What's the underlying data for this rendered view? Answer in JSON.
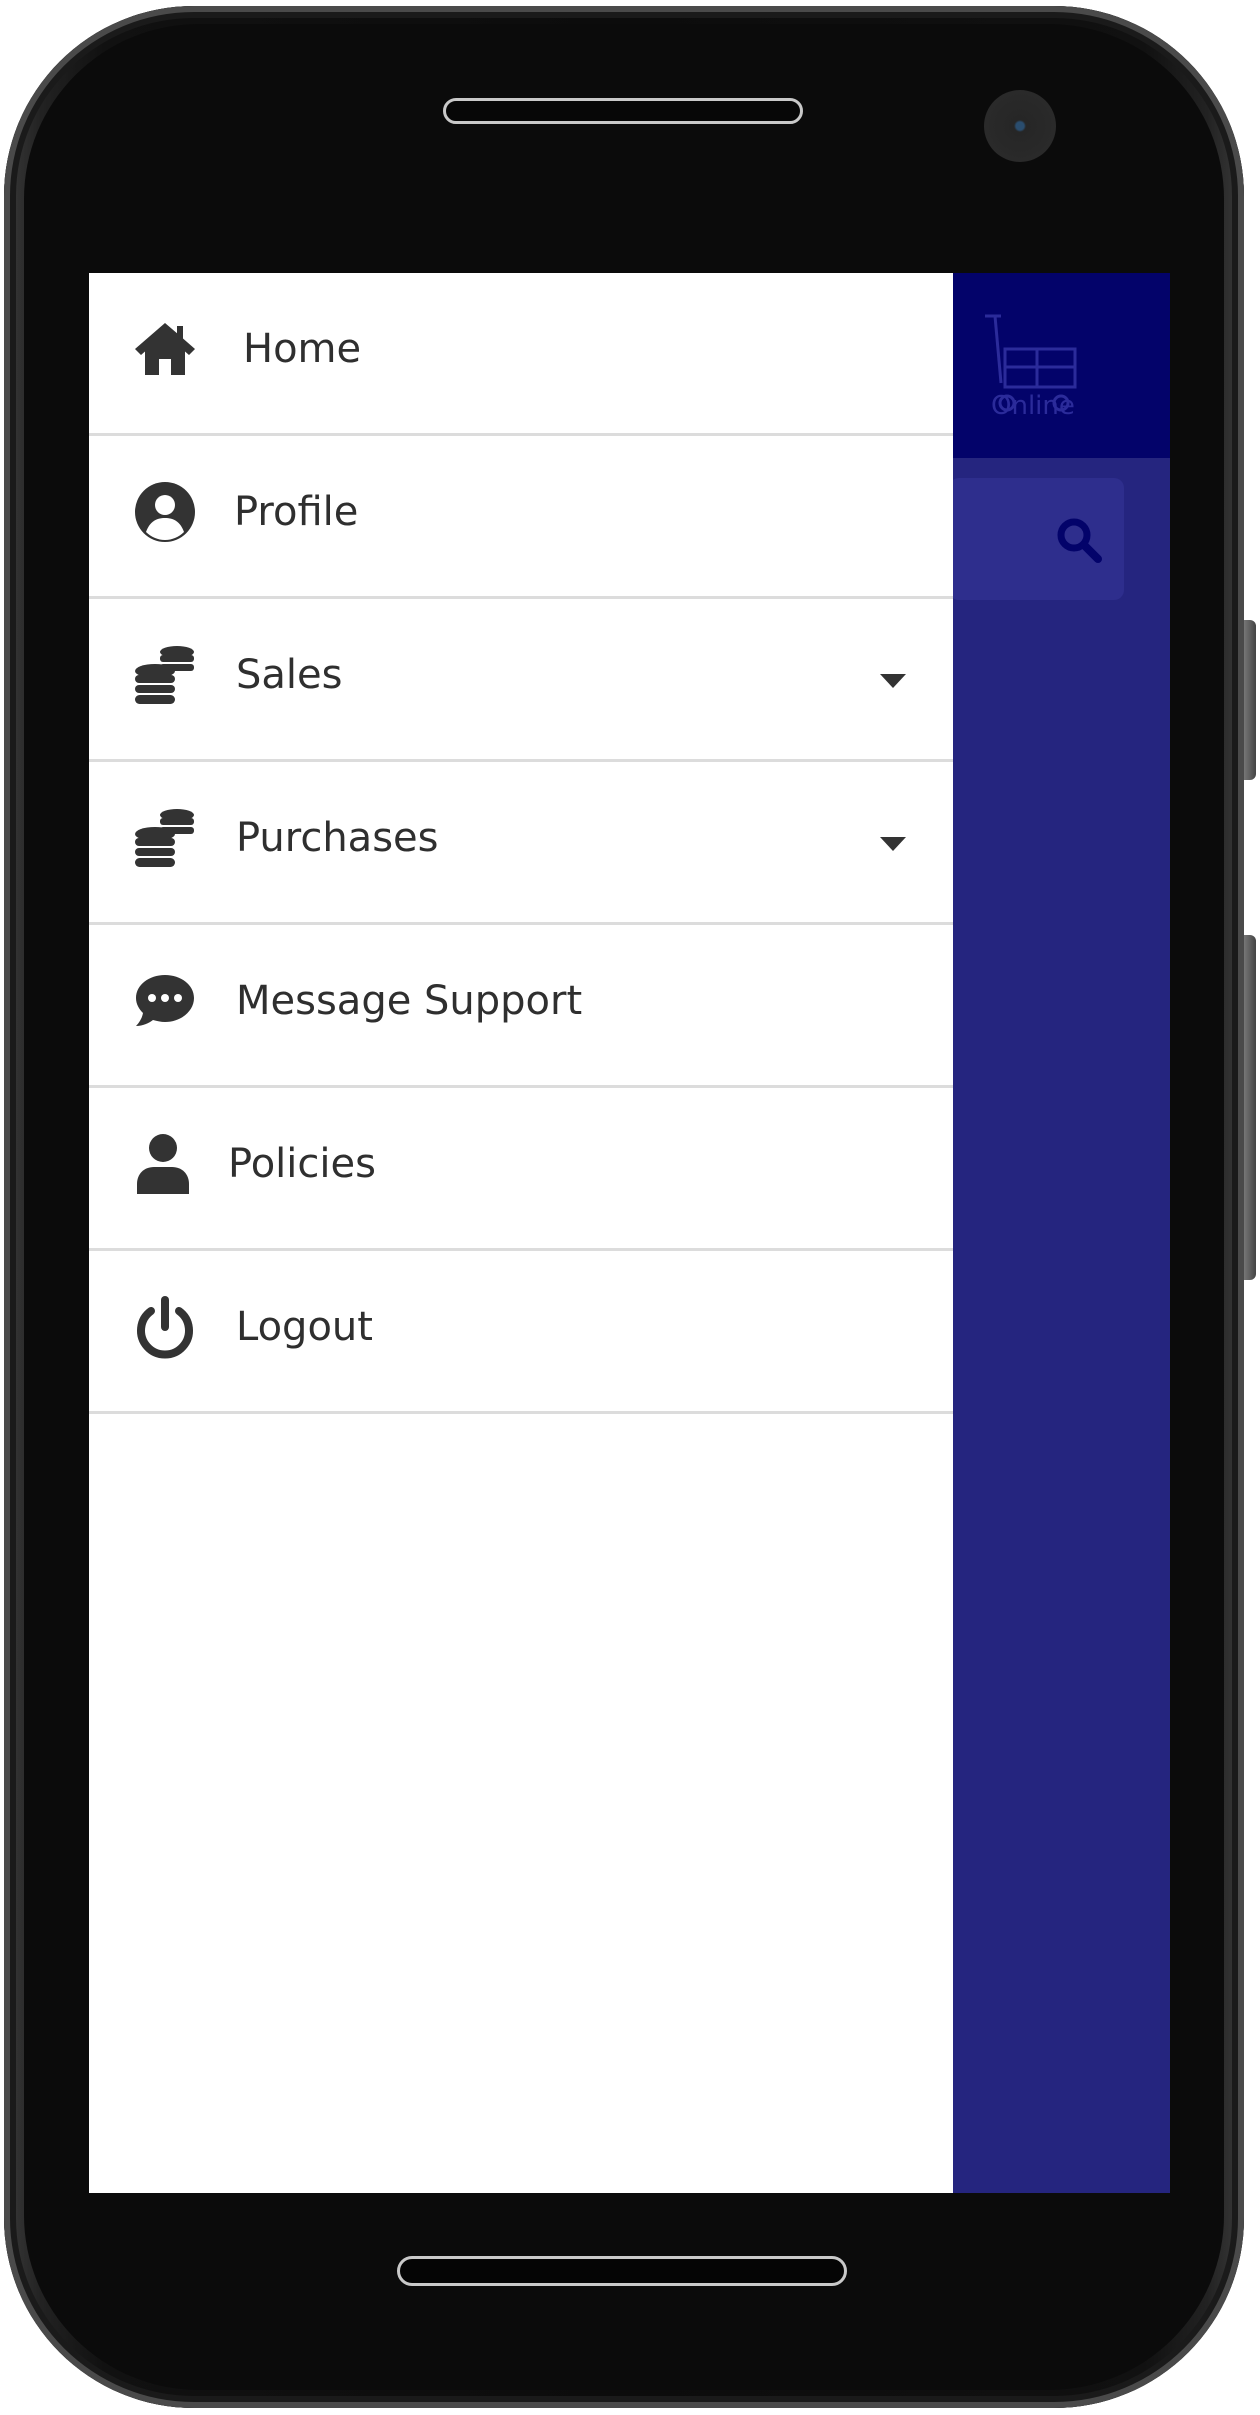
{
  "device": {
    "name": "android-phone"
  },
  "app": {
    "logo_text": "Online",
    "logo_icon": "shopping-cart-icon",
    "search_icon": "search-icon",
    "colors": {
      "header": "#03036a",
      "body": "#25257f",
      "drawer": "#ffffff",
      "menu_text": "#2f2f2f"
    }
  },
  "drawer": {
    "items": [
      {
        "label": "Home",
        "icon": "home-icon",
        "has_submenu": false
      },
      {
        "label": "Profile",
        "icon": "user-circle-icon",
        "has_submenu": false
      },
      {
        "label": "Sales",
        "icon": "coins-icon",
        "has_submenu": true
      },
      {
        "label": "Purchases",
        "icon": "coins-icon",
        "has_submenu": true
      },
      {
        "label": "Message Support",
        "icon": "chat-bubble-icon",
        "has_submenu": false
      },
      {
        "label": "Policies",
        "icon": "user-icon",
        "has_submenu": false
      },
      {
        "label": "Logout",
        "icon": "power-icon",
        "has_submenu": false
      }
    ]
  }
}
